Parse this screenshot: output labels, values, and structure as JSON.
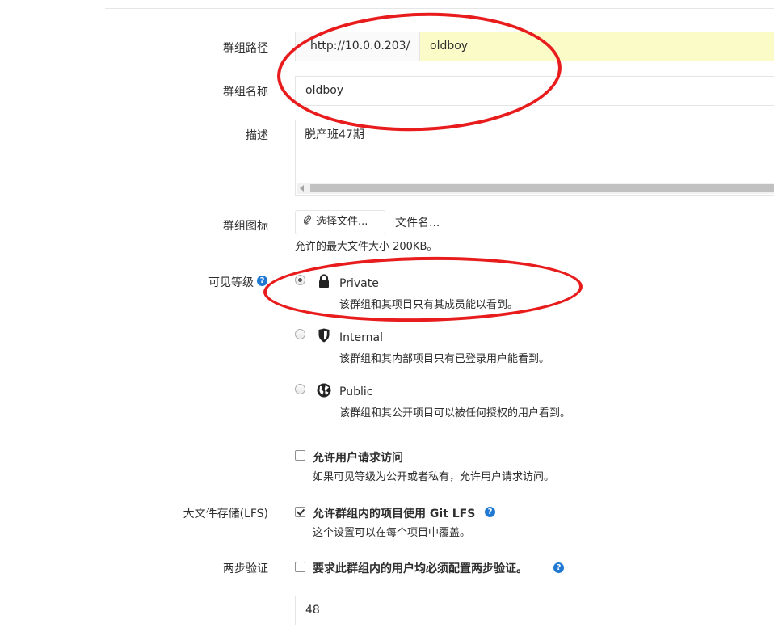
{
  "form": {
    "group_path": {
      "label": "群组路径",
      "prefix": "http://10.0.0.203/",
      "value": "oldboy"
    },
    "group_name": {
      "label": "群组名称",
      "value": "oldboy"
    },
    "description": {
      "label": "描述",
      "value": "脱产班47期"
    },
    "avatar": {
      "label": "群组图标",
      "button_label": "选择文件...",
      "file_name": "文件名...",
      "help": "允许的最大文件大小 200KB。"
    },
    "visibility": {
      "label": "可见等级",
      "options": [
        {
          "title": "Private",
          "desc": "该群组和其项目只有其成员能以看到。",
          "icon": "lock-icon",
          "checked": true
        },
        {
          "title": "Internal",
          "desc": "该群组和其内部项目只有已登录用户能看到。",
          "icon": "shield-icon",
          "checked": false
        },
        {
          "title": "Public",
          "desc": "该群组和其公开项目可以被任何授权的用户看到。",
          "icon": "globe-icon",
          "checked": false
        }
      ]
    },
    "request_access": {
      "title": "允许用户请求访问",
      "desc": "如果可见等级为公开或者私有，允许用户请求访问。",
      "checked": false
    },
    "lfs": {
      "label": "大文件存储(LFS)",
      "title": "允许群组内的项目使用 Git LFS",
      "desc": "这个设置可以在每个项目中覆盖。",
      "checked": true
    },
    "two_factor": {
      "label": "两步验证",
      "title": "要求此群组内的用户均必须配置两步验证。",
      "checked": false,
      "grace_value": "48"
    }
  },
  "colors": {
    "annotation": "#e81c1c",
    "help_icon": "#1f78d1",
    "path_highlight": "#fbfbc8"
  }
}
